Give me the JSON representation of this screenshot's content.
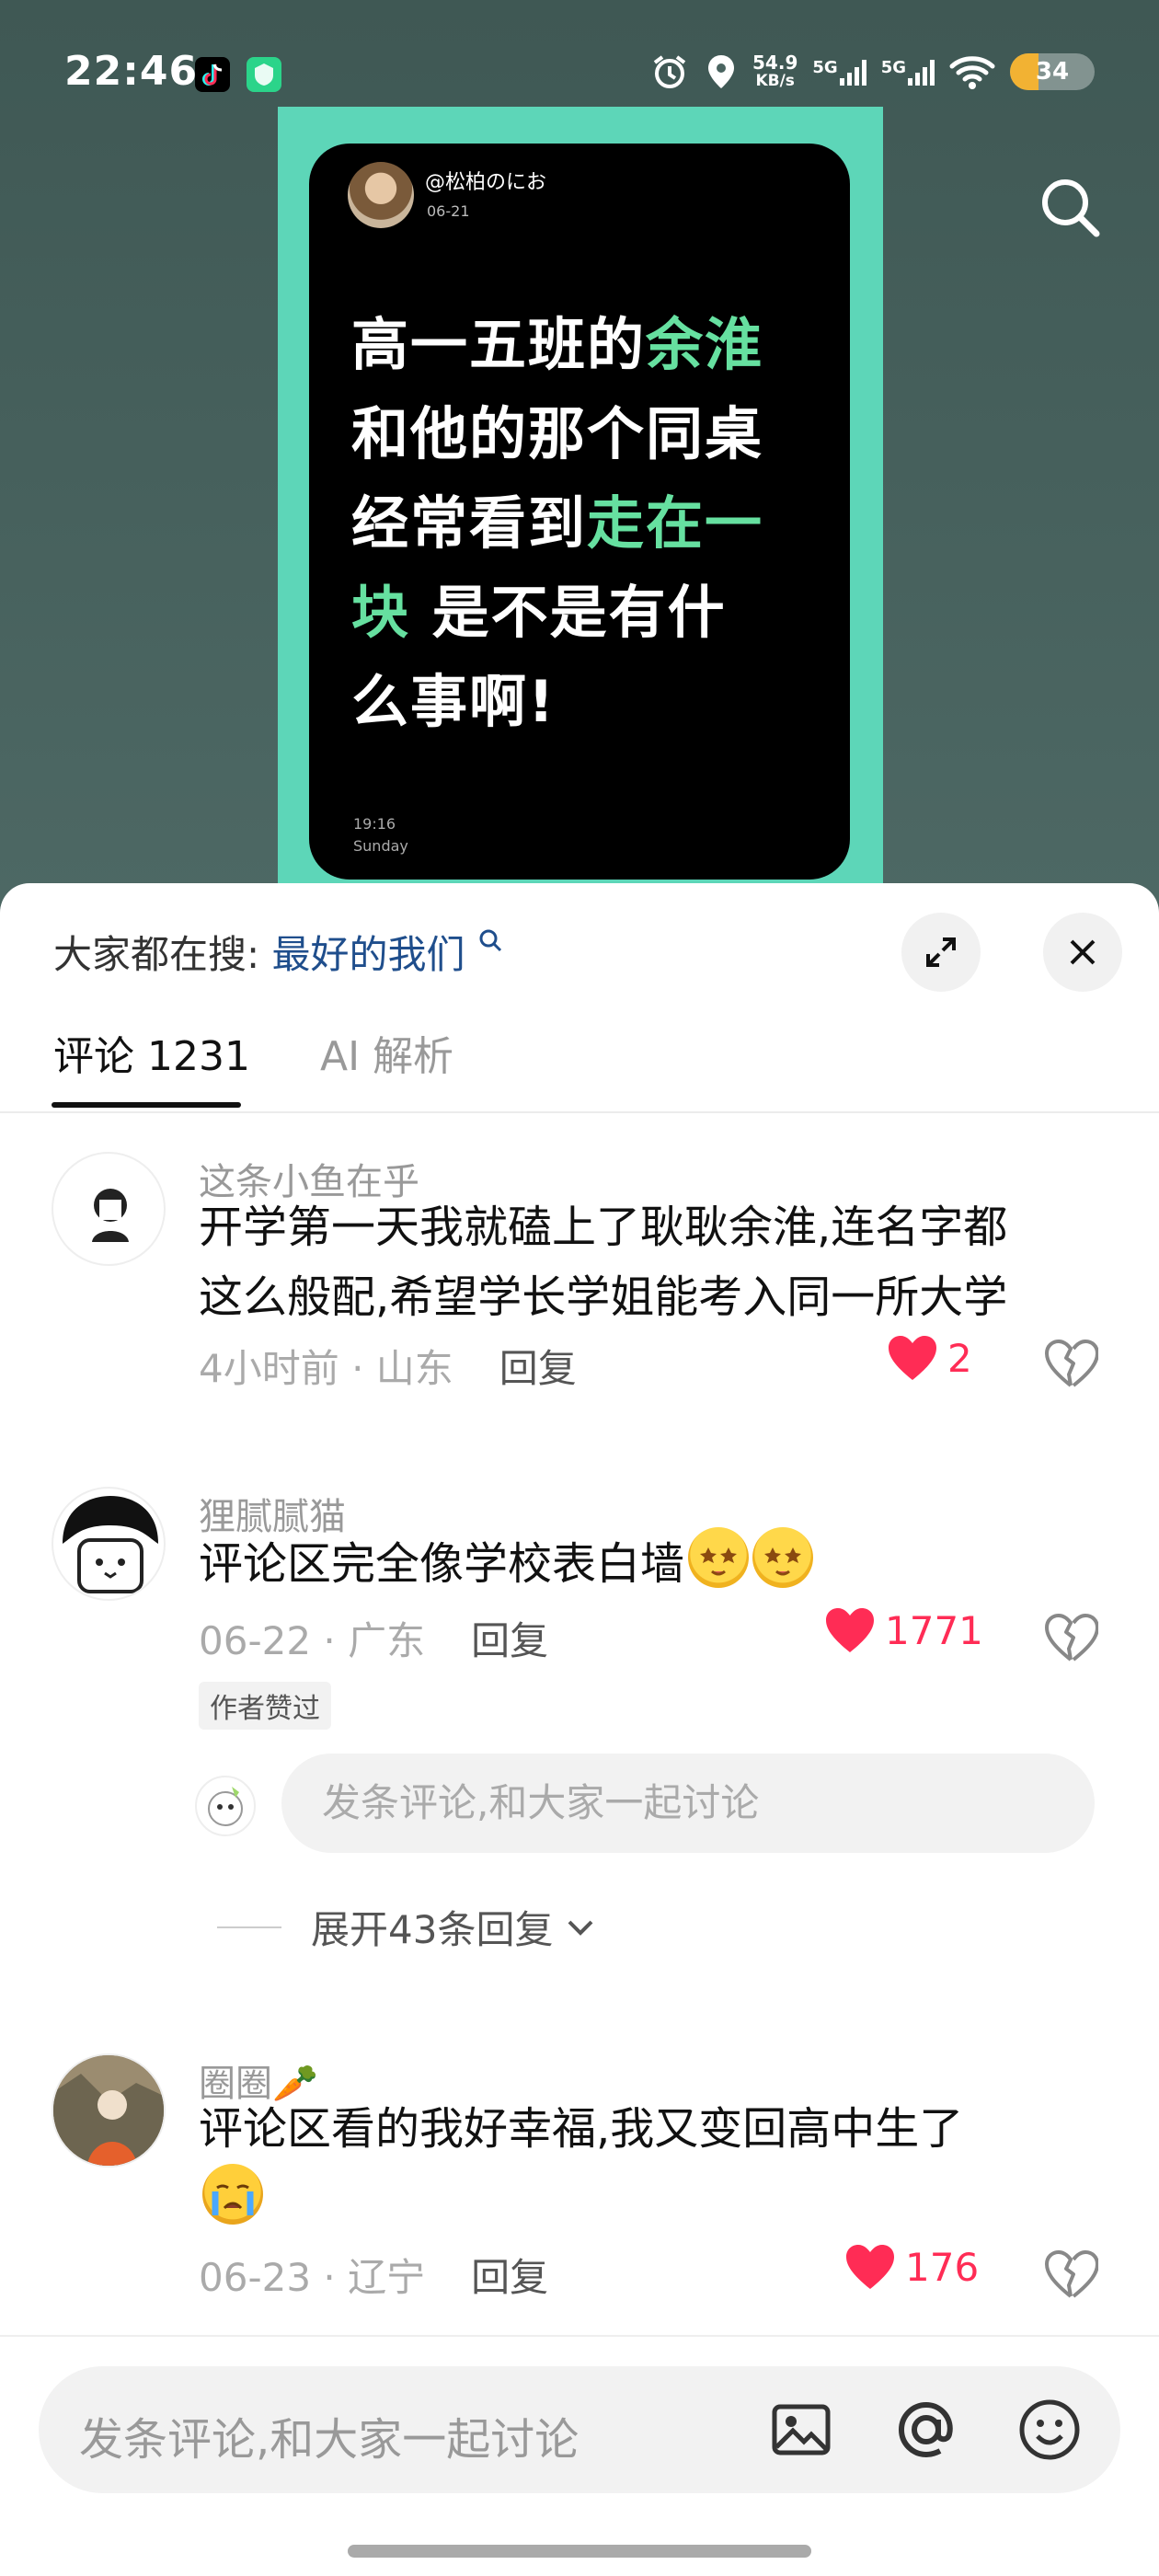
{
  "status_bar": {
    "time": "22:46",
    "net_speed_value": "54.9",
    "net_speed_unit": "KB/s",
    "sim1": "5G",
    "sim2": "5G",
    "battery": "34",
    "battery_level": 0.34,
    "icons": [
      "douyin-icon",
      "shield-app-icon",
      "alarm-icon",
      "location-icon",
      "wifi-icon"
    ]
  },
  "video": {
    "author": "@松柏のにお",
    "date": "06-21",
    "text_lines": [
      [
        {
          "t": "高一五班的",
          "hl": false
        },
        {
          "t": "余淮",
          "hl": true
        }
      ],
      [
        {
          "t": "和他的那个同桌",
          "hl": false
        }
      ],
      [
        {
          "t": "经常看到",
          "hl": false
        },
        {
          "t": "走在一",
          "hl": true
        }
      ],
      [
        {
          "t": "块",
          "hl": true
        },
        {
          "t": " 是不是有什",
          "hl": false
        }
      ],
      [
        {
          "t": "么事啊!",
          "hl": false
        }
      ]
    ],
    "clock_time": "19:16",
    "clock_day": "Sunday",
    "highlight_color": "#66e0a0",
    "poster_color": "#5dd6b8"
  },
  "sheet": {
    "search_prefix": "大家都在搜:",
    "search_term": "最好的我们",
    "tab_comments": "评论 1231",
    "tab_ai": "AI 解析"
  },
  "comments": [
    {
      "name": "这条小鱼在乎",
      "text_line1": "开学第一天我就磕上了耿耿余淮,连名字都",
      "text_line2": "这么般配,希望学长学姐能考入同一所大学",
      "meta": "4小时前 · 山东",
      "reply": "回复",
      "likes": "2"
    },
    {
      "name": "狸腻腻猫",
      "text": "评论区完全像学校表白墙",
      "meta": "06-22 · 广东",
      "reply": "回复",
      "likes": "1771",
      "badge": "作者赞过",
      "reply_placeholder": "发条评论,和大家一起讨论",
      "expand": "展开43条回复"
    },
    {
      "name": "圈圈🥕",
      "text": "评论区看的我好幸福,我又变回高中生了",
      "meta": "06-23 · 辽宁",
      "reply": "回复",
      "likes": "176"
    }
  ],
  "bottom_bar": {
    "placeholder": "发条评论,和大家一起讨论",
    "icons": [
      "image-icon",
      "at-icon",
      "emoji-icon"
    ]
  },
  "colors": {
    "like_red": "#ff2c55",
    "search_term_blue": "#1f4e8c"
  }
}
